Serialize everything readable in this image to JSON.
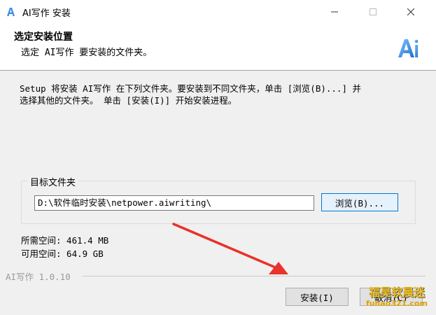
{
  "window": {
    "title": "AI写作 安装",
    "controls": {
      "minimize": "—",
      "maximize": "☐",
      "close": "✕"
    }
  },
  "header": {
    "title": "选定安装位置",
    "subtitle": "选定 AI写作 要安装的文件夹。",
    "logo_text": "Ai"
  },
  "intro": {
    "line1": "Setup 将安装 AI写作 在下列文件夹。要安装到不同文件夹，单击 [浏览(B)...] 并",
    "line2": "选择其他的文件夹。 单击 [安装(I)] 开始安装进程。"
  },
  "destination": {
    "group_label": "目标文件夹",
    "path_value": "D:\\软件临时安装\\netpower.aiwriting\\",
    "browse_label": "浏览(B)..."
  },
  "space": {
    "required": "所需空间: 461.4 MB",
    "available": "可用空间: 64.9 GB"
  },
  "footer": {
    "branding": "AI写作 1.0.10",
    "install_label": "安装(I)",
    "cancel_label": "取消(C)"
  },
  "watermark": {
    "top": "福昊软晨迷",
    "bottom": "fuhao321.com"
  },
  "colors": {
    "accent": "#0078d7",
    "arrow": "#e8322b",
    "logo": "#3a8de0"
  }
}
